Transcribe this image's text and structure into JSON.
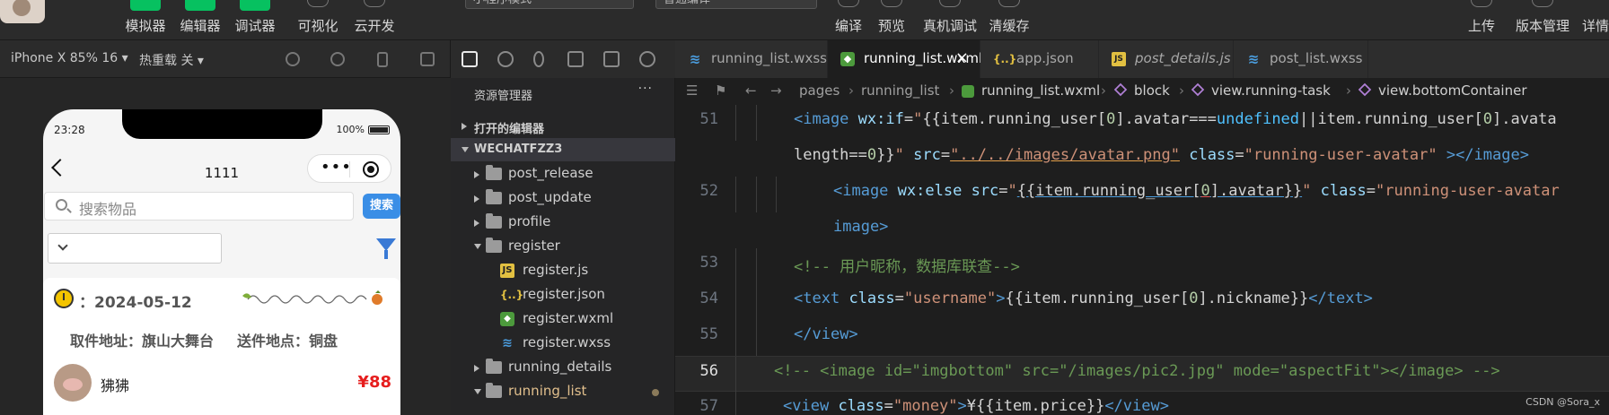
{
  "toolbar": {
    "left_buttons": [
      "模拟器",
      "编辑器",
      "调试器",
      "可视化",
      "云开发"
    ],
    "mode_select": "小程序模式",
    "compile_select": "普通编译",
    "mid_buttons": [
      "编译",
      "预览",
      "真机调试",
      "清缓存"
    ],
    "right_buttons": [
      "上传",
      "版本管理",
      "详情"
    ]
  },
  "simulator": {
    "device": "iPhone X 85% 16 ▾",
    "hot_reload": "热重载 关 ▾",
    "phone": {
      "time": "23:28",
      "battery": "100%",
      "nav_title": "1111",
      "search_placeholder": "搜索物品",
      "search_button": "搜索",
      "card": {
        "date": "：2024-05-12",
        "pickup": "取件地址：旗山大舞台",
        "delivery": "送件地点：铜盘",
        "username": "狒狒",
        "price": "¥88"
      }
    }
  },
  "explorer": {
    "title": "资源管理器",
    "more": "···",
    "open_editors": "打开的编辑器",
    "project": "WECHATFZZ3",
    "tree": [
      {
        "name": "post_release",
        "type": "folder",
        "depth": 1,
        "open": false
      },
      {
        "name": "post_update",
        "type": "folder",
        "depth": 1,
        "open": false
      },
      {
        "name": "profile",
        "type": "folder",
        "depth": 1,
        "open": false
      },
      {
        "name": "register",
        "type": "folder",
        "depth": 1,
        "open": true
      },
      {
        "name": "register.js",
        "type": "js",
        "depth": 2
      },
      {
        "name": "register.json",
        "type": "json",
        "depth": 2
      },
      {
        "name": "register.wxml",
        "type": "wxml",
        "depth": 2
      },
      {
        "name": "register.wxss",
        "type": "wxss",
        "depth": 2
      },
      {
        "name": "running_details",
        "type": "folder",
        "depth": 1,
        "open": false
      },
      {
        "name": "running_list",
        "type": "folder",
        "depth": 1,
        "open": true,
        "modified": true
      }
    ]
  },
  "editor": {
    "tabs": [
      {
        "label": "running_list.wxss",
        "type": "wxss",
        "active": false,
        "italic": false
      },
      {
        "label": "running_list.wxml",
        "type": "wxml",
        "active": true,
        "italic": false
      },
      {
        "label": "app.json",
        "type": "json",
        "active": false,
        "italic": false
      },
      {
        "label": "post_details.js",
        "type": "js",
        "active": false,
        "italic": true
      },
      {
        "label": "post_list.wxss",
        "type": "wxss",
        "active": false,
        "italic": false
      }
    ],
    "breadcrumb": [
      "pages",
      "running_list",
      "running_list.wxml",
      "block",
      "view.running-task",
      "view.bottomContainer"
    ],
    "line_numbers": [
      "51",
      "",
      "52",
      "",
      "53",
      "54",
      "55",
      "56",
      "57"
    ],
    "current_line": "56"
  },
  "watermark": "CSDN @Sora_x"
}
